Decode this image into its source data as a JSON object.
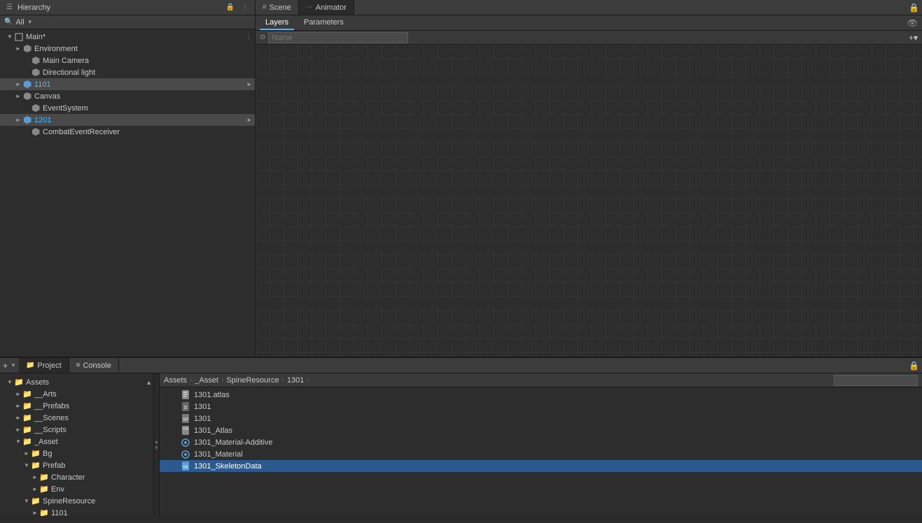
{
  "tabs": {
    "hierarchy": "Hierarchy",
    "scene": "Scene",
    "animator": "Animator"
  },
  "hierarchy": {
    "title": "Hierarchy",
    "search_placeholder": "All",
    "tree": [
      {
        "id": "main",
        "label": "Main*",
        "indent": 0,
        "arrow": "▼",
        "has_arrow": true,
        "type": "scene",
        "menu_btn": true
      },
      {
        "id": "environment",
        "label": "Environment",
        "indent": 1,
        "arrow": "►",
        "has_arrow": true,
        "type": "cube_gray"
      },
      {
        "id": "main-camera",
        "label": "Main Camera",
        "indent": 1,
        "arrow": "",
        "has_arrow": false,
        "type": "cube_gray"
      },
      {
        "id": "directional-light",
        "label": "Directional light",
        "indent": 1,
        "arrow": "",
        "has_arrow": false,
        "type": "cube_gray"
      },
      {
        "id": "1101",
        "label": "1101",
        "indent": 1,
        "arrow": "►",
        "has_arrow": true,
        "type": "cube_blue",
        "right_arrow": true,
        "blue": true
      },
      {
        "id": "canvas",
        "label": "Canvas",
        "indent": 1,
        "arrow": "►",
        "has_arrow": true,
        "type": "cube_gray"
      },
      {
        "id": "event-system",
        "label": "EventSystem",
        "indent": 1,
        "arrow": "",
        "has_arrow": false,
        "type": "cube_gray"
      },
      {
        "id": "1201",
        "label": "1201",
        "indent": 1,
        "arrow": "►",
        "has_arrow": true,
        "type": "cube_blue",
        "right_arrow": true,
        "blue": true
      },
      {
        "id": "combat-event-receiver",
        "label": "CombatEventReceiver",
        "indent": 1,
        "arrow": "",
        "has_arrow": false,
        "type": "cube_gray"
      }
    ]
  },
  "animator": {
    "tabs": [
      {
        "label": "Layers",
        "active": true
      },
      {
        "label": "Parameters",
        "active": false
      }
    ],
    "name_placeholder": "Name"
  },
  "bottom": {
    "tabs": [
      {
        "label": "Project",
        "active": true,
        "icon": "📁"
      },
      {
        "label": "Console",
        "active": false,
        "icon": "≡"
      }
    ],
    "add_btn": "+",
    "project_tree": [
      {
        "label": "Assets",
        "indent": 0,
        "arrow": "▼",
        "expanded": true,
        "type": "folder"
      },
      {
        "label": "__Arts",
        "indent": 1,
        "arrow": "►",
        "expanded": false,
        "type": "folder"
      },
      {
        "label": "__Prefabs",
        "indent": 1,
        "arrow": "►",
        "expanded": false,
        "type": "folder"
      },
      {
        "label": "__Scenes",
        "indent": 1,
        "arrow": "►",
        "expanded": false,
        "type": "folder"
      },
      {
        "label": "__Scripts",
        "indent": 1,
        "arrow": "►",
        "expanded": false,
        "type": "folder"
      },
      {
        "label": "_Asset",
        "indent": 1,
        "arrow": "▼",
        "expanded": true,
        "type": "folder"
      },
      {
        "label": "Bg",
        "indent": 2,
        "arrow": "►",
        "expanded": false,
        "type": "folder"
      },
      {
        "label": "Prefab",
        "indent": 2,
        "arrow": "▼",
        "expanded": true,
        "type": "folder"
      },
      {
        "label": "Character",
        "indent": 3,
        "arrow": "►",
        "expanded": false,
        "type": "folder"
      },
      {
        "label": "Env",
        "indent": 3,
        "arrow": "►",
        "expanded": false,
        "type": "folder"
      },
      {
        "label": "SpineResource",
        "indent": 2,
        "arrow": "▼",
        "expanded": true,
        "type": "folder"
      },
      {
        "label": "1101",
        "indent": 3,
        "arrow": "►",
        "expanded": false,
        "type": "folder"
      }
    ],
    "breadcrumbs": [
      "Assets",
      "_Asset",
      "SpineResource",
      "1301"
    ],
    "files": [
      {
        "label": "1301.atlas",
        "type": "text",
        "selected": false
      },
      {
        "label": "1301",
        "type": "spine",
        "selected": false
      },
      {
        "label": "1301",
        "type": "spine2",
        "selected": false
      },
      {
        "label": "1301_Atlas",
        "type": "atlas2",
        "selected": false
      },
      {
        "label": "1301_Material-Additive",
        "type": "material",
        "selected": false
      },
      {
        "label": "1301_Material",
        "type": "material",
        "selected": false
      },
      {
        "label": "1301_SkeletonData",
        "type": "skeleton",
        "selected": true
      }
    ]
  }
}
